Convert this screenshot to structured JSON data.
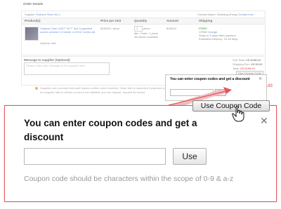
{
  "order": {
    "title": "Order Details",
    "supplier_label": "Supplier",
    "supplier_name": "Ephone Store No.1",
    "contact_name_label": "Contact Name",
    "contact_name": "Guoliang Zhong",
    "contact_now": "Contact now",
    "columns": [
      "Product(s)",
      "Price per Unit",
      "Quantity",
      "Amount",
      "Shipping"
    ],
    "row": {
      "product_name": "Original Cube U9GT V5 7\" 8x5 Capacitive screen android 2.3 tablet 1.2GHZ Cortex-A8",
      "product_options": "Options: N/A",
      "price": "$158.63 / piece",
      "quantity": "1",
      "qty_unit": "piece",
      "min_order": "Min. Order: 1 piece",
      "stock": "38 pieces available",
      "amount": "$158.63",
      "shipping_free": "FREE!",
      "shipping_method": "CPAM",
      "shipping_change": "Change",
      "shipping_days": "Ships in 3 days after payment",
      "delivery": "Estimated Delivery: 15-45 days"
    },
    "message_label": "Message to supplier (Optional)",
    "message_placeholder": "Please enter your message to the supplier here",
    "totals": {
      "subtotal_label": "Sub Total:",
      "subtotal": "US $158.63",
      "shipping_label": "Shipping Fee:",
      "shipping": "US $0.00",
      "total_label": "Total:",
      "total": "US $158.63"
    },
    "use_coupon_small": "Use Coupon Code",
    "notice_line1": "Suppliers are currently held until buyers confirm order received. Order will be cancelled if payment is not completed within 10 days.",
    "notice_line2": "If a supplier fails to deliver or you're not satisfied, you can dispute. request for refund",
    "side_price": "$0.83"
  },
  "mini_popup": {
    "title": "You can enter coupon codes and get a discount",
    "use": "Use"
  },
  "popup": {
    "trigger_label": "Use Coupon Code",
    "title": "You can enter coupon codes and get a discount",
    "input_value": "",
    "use_button": "Use",
    "hint": "Coupon code should be characters within the scope of 0-9 & a-z",
    "close_glyph": "✕"
  },
  "colors": {
    "popup_border": "#e3585d",
    "accent_red": "#d93a3a",
    "link_blue": "#1a5bb5",
    "hint_gray": "#999999"
  }
}
